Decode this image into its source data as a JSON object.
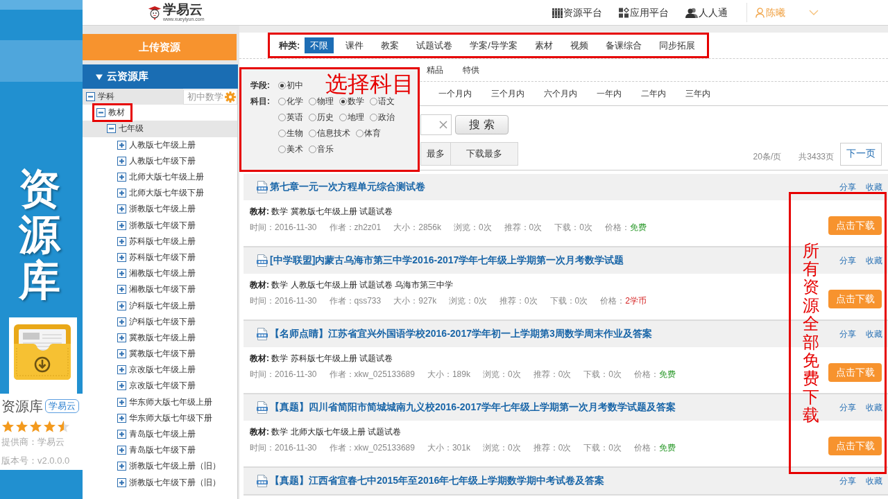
{
  "banner": {
    "title": "资源库",
    "app_name": "资源库",
    "badge": "学易云",
    "stars": 4.5,
    "provider": "提供商：学易云",
    "version": "版本号：v2.0.0.0"
  },
  "header": {
    "logo": "学易云",
    "logo_url": "www.xueyiyun.com",
    "nav": [
      {
        "label": "资源平台",
        "kind": "books"
      },
      {
        "label": "应用平台",
        "kind": "apps"
      },
      {
        "label": "人人通",
        "kind": "people"
      }
    ],
    "user": "陈曦"
  },
  "sidebar": {
    "upload": "上传资源",
    "section": {
      "title": "云资源库",
      "expanded": true
    },
    "subject_picker": "初中数学",
    "tree": [
      {
        "label": "学科",
        "expanded": true,
        "selected": true,
        "children": [
          {
            "label": "教材",
            "expanded": true,
            "selected": false,
            "highlighted": true,
            "children": [
              {
                "label": "七年级",
                "expanded": true,
                "selected": true,
                "children": [
                  {
                    "label": "人教版七年级上册",
                    "expanded": false,
                    "selected": false
                  },
                  {
                    "label": "人教版七年级下册",
                    "expanded": false,
                    "selected": false
                  },
                  {
                    "label": "北师大版七年级上册",
                    "expanded": false,
                    "selected": false
                  },
                  {
                    "label": "北师大版七年级下册",
                    "expanded": false,
                    "selected": false
                  },
                  {
                    "label": "浙教版七年级上册",
                    "expanded": false,
                    "selected": false
                  },
                  {
                    "label": "浙教版七年级下册",
                    "expanded": false,
                    "selected": false
                  },
                  {
                    "label": "苏科版七年级上册",
                    "expanded": false,
                    "selected": false
                  },
                  {
                    "label": "苏科版七年级下册",
                    "expanded": false,
                    "selected": false
                  },
                  {
                    "label": "湘教版七年级上册",
                    "expanded": false,
                    "selected": false
                  },
                  {
                    "label": "湘教版七年级下册",
                    "expanded": false,
                    "selected": false
                  },
                  {
                    "label": "沪科版七年级上册",
                    "expanded": false,
                    "selected": false
                  },
                  {
                    "label": "沪科版七年级下册",
                    "expanded": false,
                    "selected": false
                  },
                  {
                    "label": "冀教版七年级上册",
                    "expanded": false,
                    "selected": false
                  },
                  {
                    "label": "冀教版七年级下册",
                    "expanded": false,
                    "selected": false
                  },
                  {
                    "label": "京改版七年级上册",
                    "expanded": false,
                    "selected": false
                  },
                  {
                    "label": "京改版七年级下册",
                    "expanded": false,
                    "selected": false
                  },
                  {
                    "label": "华东师大版七年级上册",
                    "expanded": false,
                    "selected": false
                  },
                  {
                    "label": "华东师大版七年级下册",
                    "expanded": false,
                    "selected": false
                  },
                  {
                    "label": "青岛版七年级上册",
                    "expanded": false,
                    "selected": false
                  },
                  {
                    "label": "青岛版七年级下册",
                    "expanded": false,
                    "selected": false
                  },
                  {
                    "label": "浙教版七年级上册（旧）",
                    "expanded": false,
                    "selected": false
                  },
                  {
                    "label": "浙教版七年级下册（旧）",
                    "expanded": false,
                    "selected": false
                  }
                ]
              }
            ]
          }
        ]
      }
    ]
  },
  "filters": [
    {
      "label": "种类:",
      "highlighted": true,
      "options": [
        {
          "label": "不限",
          "selected": true
        },
        {
          "label": "课件",
          "selected": false
        },
        {
          "label": "教案",
          "selected": false
        },
        {
          "label": "试题试卷",
          "selected": false
        },
        {
          "label": "学案/导学案",
          "selected": false
        },
        {
          "label": "素材",
          "selected": false
        },
        {
          "label": "视频",
          "selected": false
        },
        {
          "label": "备课综合",
          "selected": false
        },
        {
          "label": "同步拓展",
          "selected": false
        }
      ]
    },
    {
      "options": [
        {
          "label": "精品",
          "selected": false
        },
        {
          "label": "特供",
          "selected": false
        }
      ]
    },
    {
      "options": [
        {
          "label": "一个月内",
          "selected": false
        },
        {
          "label": "三个月内",
          "selected": false
        },
        {
          "label": "六个月内",
          "selected": false
        },
        {
          "label": "一年内",
          "selected": false
        },
        {
          "label": "二年内",
          "selected": false
        },
        {
          "label": "三年内",
          "selected": false
        }
      ]
    }
  ],
  "search": {
    "button": "搜 索"
  },
  "sort": [
    {
      "label": "最多",
      "selected": false
    },
    {
      "label": "下载最多",
      "selected": false
    }
  ],
  "pagination": {
    "per_page": "20条/页",
    "total": "共3433页",
    "next": "下一页"
  },
  "popup": {
    "highlighted": true,
    "annotation": "选择科目",
    "groups": [
      {
        "label": "学段:",
        "options": [
          {
            "label": "初中",
            "selected": true
          }
        ]
      },
      {
        "label": "科目:",
        "options": [
          {
            "label": "化学",
            "selected": false
          },
          {
            "label": "物理",
            "selected": false
          },
          {
            "label": "数学",
            "selected": true
          },
          {
            "label": "语文",
            "selected": false
          },
          {
            "label": "英语",
            "selected": false
          },
          {
            "label": "历史",
            "selected": false
          },
          {
            "label": "地理",
            "selected": false
          },
          {
            "label": "政治",
            "selected": false
          },
          {
            "label": "生物",
            "selected": false
          },
          {
            "label": "信息技术",
            "selected": false
          },
          {
            "label": "体育",
            "selected": false
          },
          {
            "label": "美术",
            "selected": false
          },
          {
            "label": "音乐",
            "selected": false
          }
        ]
      }
    ]
  },
  "resources": [
    {
      "title": "第七章一元一次方程单元综合测试卷",
      "actions": [
        "分享",
        "收藏"
      ],
      "tags": "**教材:** 数学 冀教版七年级上册 试题试卷",
      "meta": [
        "时间：2016-11-30",
        "作者：zh2z01",
        "大小：2856k",
        "浏览：0次",
        "推荐：0次",
        "下载：0次"
      ],
      "price": {
        "label": "价格：",
        "value": "免费",
        "kind": "free"
      },
      "download": "点击下载"
    },
    {
      "title": "[中学联盟]内蒙古乌海市第三中学2016-2017学年七年级上学期第一次月考数学试题",
      "actions": [
        "分享",
        "收藏"
      ],
      "tags": "**教材:** 数学 人教版七年级上册 试题试卷 乌海市第三中学",
      "meta": [
        "时间：2016-11-30",
        "作者：qss733",
        "大小：927k",
        "浏览：0次",
        "推荐：0次",
        "下载：0次"
      ],
      "price": {
        "label": "价格：",
        "value": "2学币",
        "kind": "paid"
      },
      "download": "点击下载"
    },
    {
      "title": "【名师点睛】江苏省宜兴外国语学校2016-2017学年初一上学期第3周数学周末作业及答案",
      "actions": [
        "分享",
        "收藏"
      ],
      "tags": "**教材:** 数学 苏科版七年级上册 试题试卷",
      "meta": [
        "时间：2016-11-30",
        "作者：xkw_025133689",
        "大小：189k",
        "浏览：0次",
        "推荐：0次",
        "下载：0次"
      ],
      "price": {
        "label": "价格：",
        "value": "免费",
        "kind": "free"
      },
      "download": "点击下载"
    },
    {
      "title": "【真题】四川省简阳市简城城南九义校2016-2017学年七年级上学期第一次月考数学试题及答案",
      "actions": [
        "分享",
        "收藏"
      ],
      "tags": "**教材:** 数学 北师大版七年级上册 试题试卷",
      "meta": [
        "时间：2016-11-30",
        "作者：xkw_025133689",
        "大小：301k",
        "浏览：0次",
        "推荐：0次",
        "下载：0次"
      ],
      "price": {
        "label": "价格：",
        "value": "免费",
        "kind": "free"
      },
      "download": "点击下载"
    },
    {
      "title": "【真题】江西省宜春七中2015年至2016年七年级上学期数学期中考试卷及答案",
      "actions": [
        "分享",
        "收藏"
      ]
    }
  ],
  "callout": {
    "text": "所有资源全部免费下载"
  }
}
